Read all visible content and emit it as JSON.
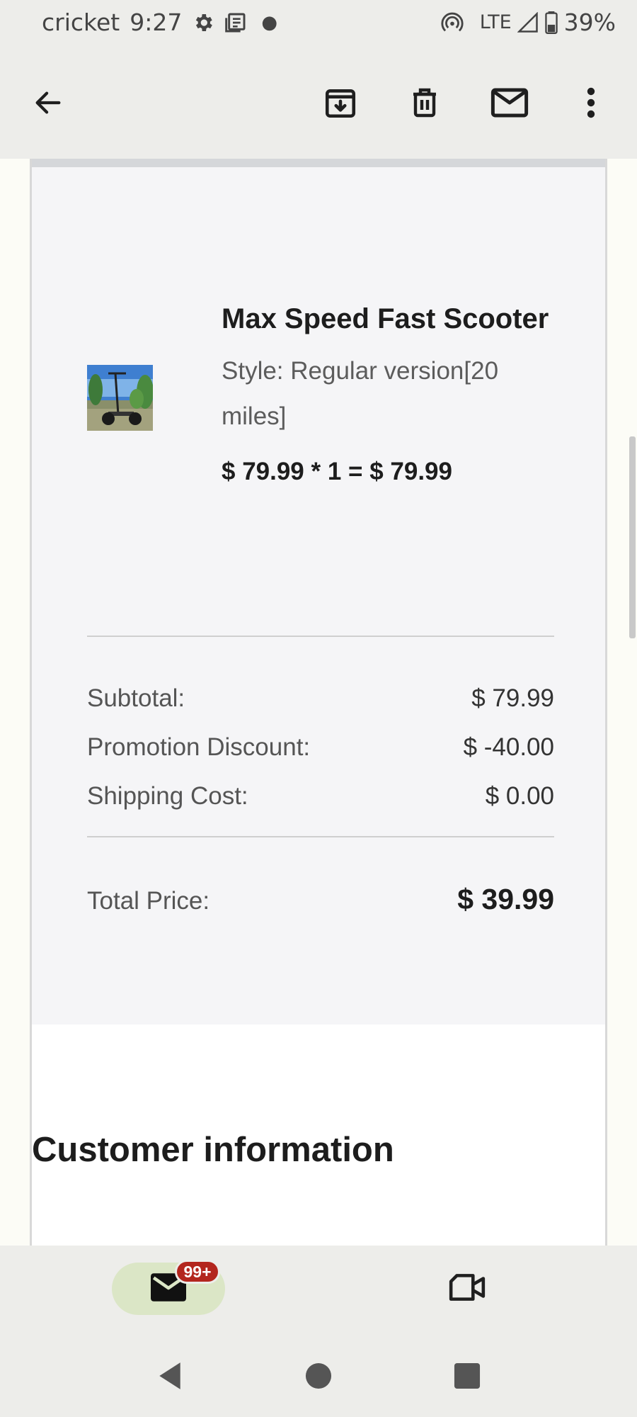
{
  "status_bar": {
    "carrier": "cricket",
    "time": "9:27",
    "network": "LTE",
    "battery": "39%",
    "icons": [
      "settings-icon",
      "news-icon",
      "notification-dot",
      "hotspot-icon",
      "signal-icon",
      "battery-icon"
    ]
  },
  "app_bar": {
    "icons": [
      "back-arrow-icon",
      "archive-icon",
      "delete-icon",
      "mark-unread-icon",
      "more-vert-icon"
    ]
  },
  "order": {
    "product_name": "Max Speed Fast Scooter",
    "product_style": "Style: Regular version[20 miles]",
    "product_price_line": "$ 79.99 * 1 = $ 79.99",
    "product_image": "scooter-photo",
    "summary": {
      "subtotal_label": "Subtotal:",
      "subtotal_value": "$ 79.99",
      "discount_label": "Promotion Discount:",
      "discount_value": "$ -40.00",
      "shipping_label": "Shipping Cost:",
      "shipping_value": "$ 0.00",
      "total_label": "Total Price:",
      "total_value": "$ 39.99"
    }
  },
  "customer_section": {
    "heading": "Customer information"
  },
  "bottom_nav": {
    "mail_badge": "99+",
    "icons": [
      "mail-icon",
      "video-call-icon"
    ]
  },
  "system_nav": {
    "icons": [
      "back-triangle-icon",
      "home-circle-icon",
      "recents-square-icon"
    ]
  },
  "colors": {
    "chrome_bg": "#ededea",
    "panel_bg": "#f5f5f7",
    "badge_red": "#b3261e",
    "nav_pill": "#dbe6c6"
  }
}
